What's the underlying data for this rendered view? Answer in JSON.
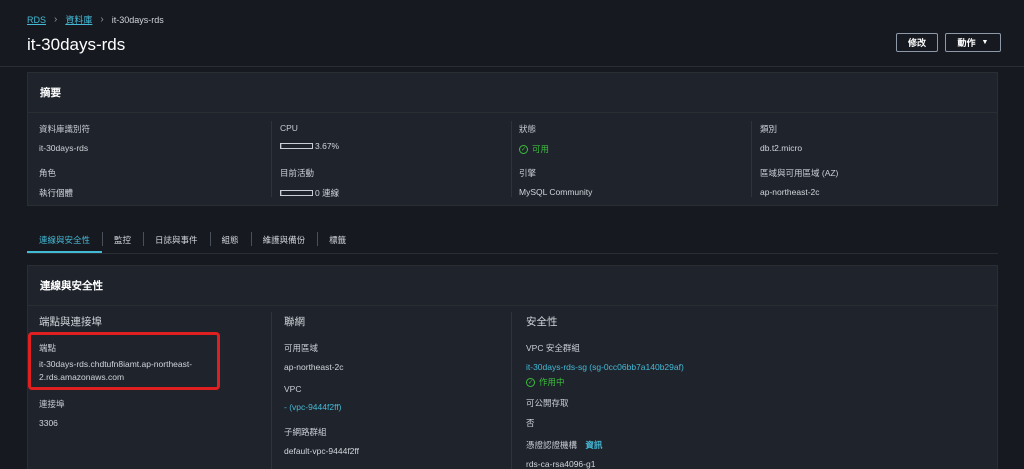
{
  "breadcrumb": {
    "rds": "RDS",
    "databases": "資料庫",
    "current": "it-30days-rds"
  },
  "page_title": "it-30days-rds",
  "buttons": {
    "edit": "修改",
    "actions": "動作"
  },
  "summary": {
    "header": "摘要",
    "db_identifier_label": "資料庫識別符",
    "db_identifier": "it-30days-rds",
    "cpu_label": "CPU",
    "cpu_value": "3.67%",
    "cpu_fraction": 0.0367,
    "status_label": "狀態",
    "status_value": "可用",
    "class_label": "類別",
    "class_value": "db.t2.micro",
    "role_label": "角色",
    "role_value": "執行個體",
    "activity_label": "目前活動",
    "activity_value": "0 連線",
    "activity_fraction": 0.02,
    "engine_label": "引擎",
    "engine_value": "MySQL Community",
    "region_label": "區域與可用區域 (AZ)",
    "region_value": "ap-northeast-2c"
  },
  "tabs": [
    "連線與安全性",
    "監控",
    "日誌與事件",
    "組態",
    "維護與備份",
    "標籤"
  ],
  "connectivity": {
    "header": "連線與安全性",
    "endpoint_section": "端點與連接埠",
    "endpoint_label": "端點",
    "endpoint_line1": "it-30days-rds.chdtufn8iamt.ap-northeast-",
    "endpoint_line2": "2.rds.amazonaws.com",
    "port_label": "連接埠",
    "port_value": "3306",
    "network_section": "聯網",
    "az_label": "可用區域",
    "az_value": "ap-northeast-2c",
    "vpc_label": "VPC",
    "vpc_value": "- (vpc-9444f2ff)",
    "subnet_label": "子網路群組",
    "subnet_value": "default-vpc-9444f2ff",
    "security_section": "安全性",
    "sg_label": "VPC 安全群組",
    "sg_value": "it-30days-rds-sg (sg-0cc06bb7a140b29af)",
    "sg_status": "作用中",
    "public_label": "可公開存取",
    "public_value": "否",
    "ca_label": "憑證認證機構",
    "ca_info": "資訊",
    "ca_value": "rds-ca-rsa4096-g1"
  }
}
